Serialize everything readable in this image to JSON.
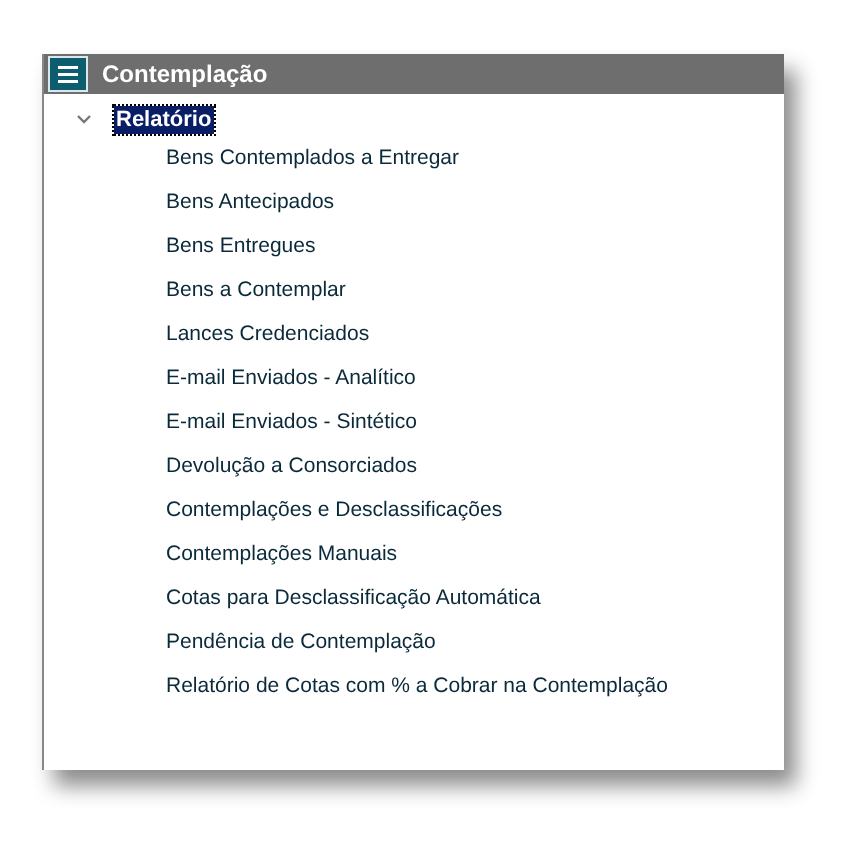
{
  "window": {
    "title": "Contemplação"
  },
  "tree": [
    {
      "label": "Relatório",
      "expanded": true,
      "selected": true,
      "children": [
        {
          "label": "Bens Contemplados a Entregar"
        },
        {
          "label": "Bens Antecipados"
        },
        {
          "label": "Bens Entregues"
        },
        {
          "label": "Bens a Contemplar"
        },
        {
          "label": "Lances Credenciados"
        },
        {
          "label": "E-mail Enviados - Analítico"
        },
        {
          "label": "E-mail Enviados - Sintético"
        },
        {
          "label": "Devolução a Consorciados"
        },
        {
          "label": "Contemplações e Desclassificações"
        },
        {
          "label": "Contemplações Manuais"
        },
        {
          "label": "Cotas para Desclassificação Automática"
        },
        {
          "label": "Pendência de Contemplação"
        },
        {
          "label": "Relatório de Cotas com % a Cobrar na Contemplação"
        }
      ]
    }
  ]
}
